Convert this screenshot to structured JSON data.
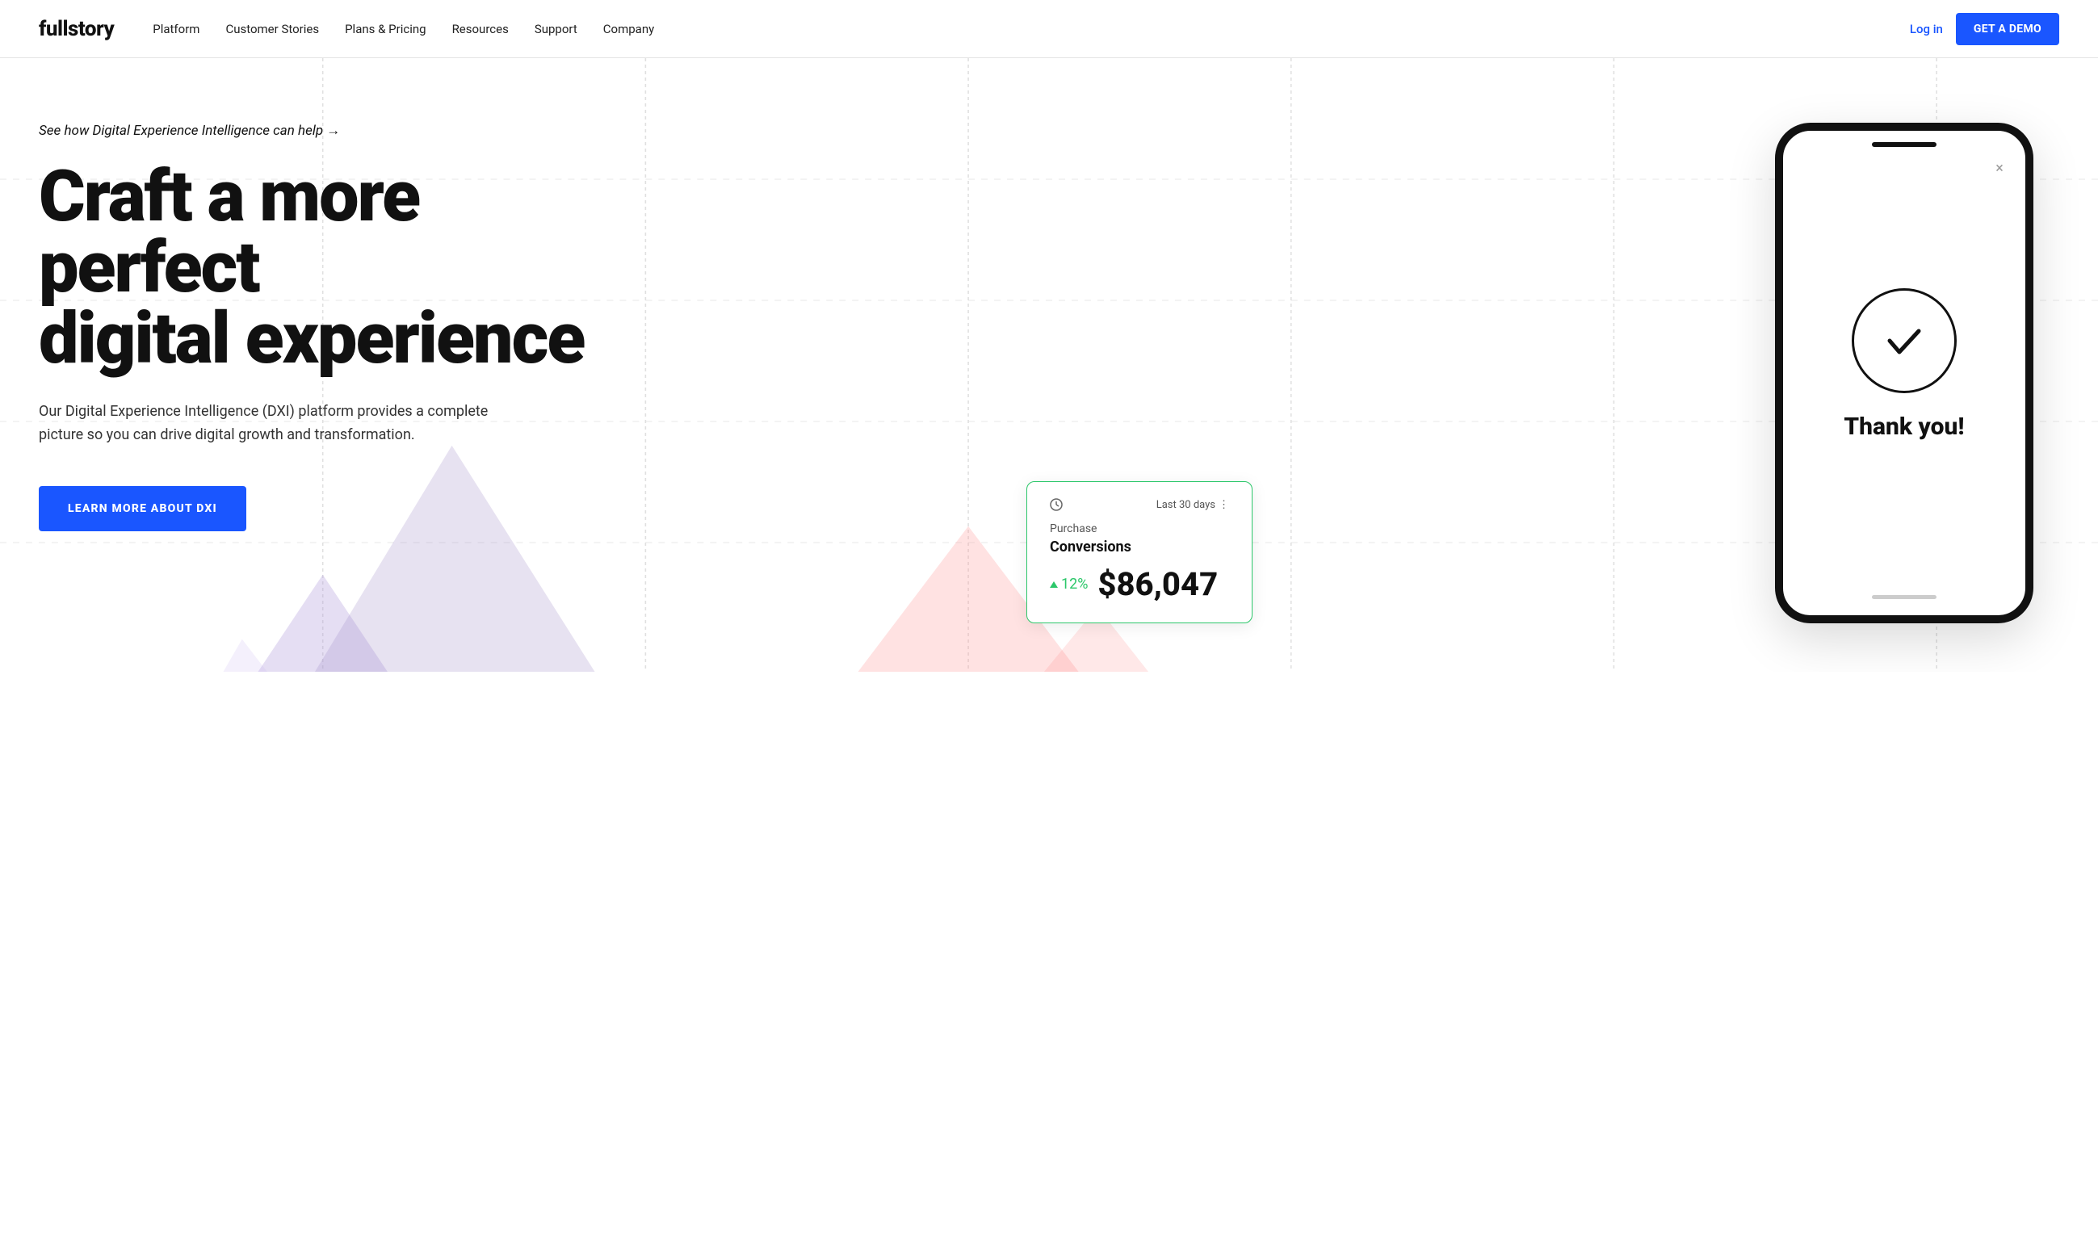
{
  "nav": {
    "logo": "fullstory",
    "links": [
      {
        "id": "platform",
        "label": "Platform"
      },
      {
        "id": "customer-stories",
        "label": "Customer Stories"
      },
      {
        "id": "plans-pricing",
        "label": "Plans & Pricing"
      },
      {
        "id": "resources",
        "label": "Resources"
      },
      {
        "id": "support",
        "label": "Support"
      },
      {
        "id": "company",
        "label": "Company"
      }
    ],
    "login_label": "Log in",
    "demo_label": "GET A DEMO"
  },
  "hero": {
    "tag_text": "See how Digital Experience Intelligence can help →",
    "title_line1": "Craft a more perfect",
    "title_line2": "digital experience",
    "description": "Our Digital Experience Intelligence (DXI) platform provides a complete picture so you can drive digital growth and transformation.",
    "cta_label": "LEARN MORE ABOUT DXI"
  },
  "conversion_card": {
    "period": "Last 30 days",
    "period_icon": "dots-icon",
    "label": "Purchase",
    "metric": "Conversions",
    "pct_change": "12%",
    "amount": "$86,047"
  },
  "phone": {
    "close_icon": "×",
    "thank_you": "Thank you!"
  }
}
